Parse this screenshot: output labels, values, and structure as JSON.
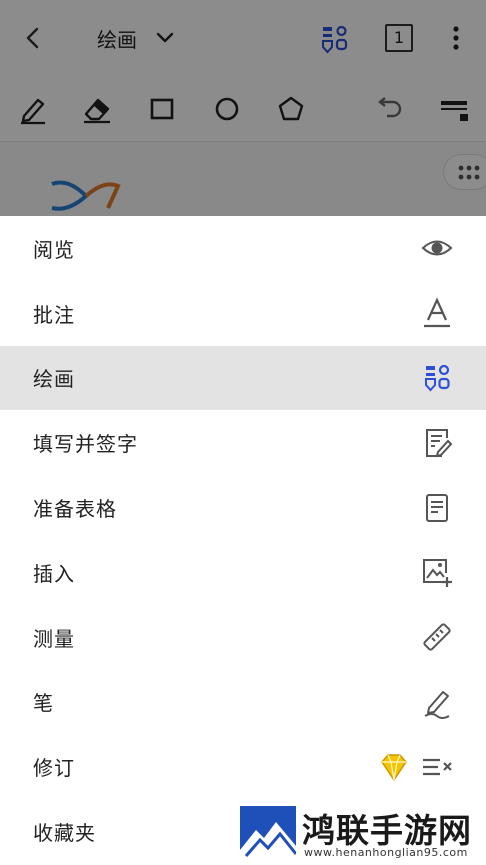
{
  "topbar": {
    "mode_title": "绘画",
    "page_number": "1"
  },
  "menu": {
    "items": [
      {
        "label": "阅览",
        "icon": "eye-icon"
      },
      {
        "label": "批注",
        "icon": "annotate-text-icon"
      },
      {
        "label": "绘画",
        "icon": "draw-mode-icon",
        "selected": true
      },
      {
        "label": "填写并签字",
        "icon": "fill-sign-icon"
      },
      {
        "label": "准备表格",
        "icon": "form-icon"
      },
      {
        "label": "插入",
        "icon": "insert-image-icon"
      },
      {
        "label": "测量",
        "icon": "ruler-icon"
      },
      {
        "label": "笔",
        "icon": "pen-icon"
      },
      {
        "label": "修订",
        "icon": "redact-icon",
        "premium": true
      },
      {
        "label": "收藏夹",
        "icon": "favorites-icon"
      }
    ]
  },
  "colors": {
    "accent": "#2f4fd6",
    "premium": "#e8b400",
    "selected_bg": "#e3e3e3"
  },
  "watermark": {
    "title": "鸿联手游网",
    "url": "www.henanhonglian95.com"
  }
}
